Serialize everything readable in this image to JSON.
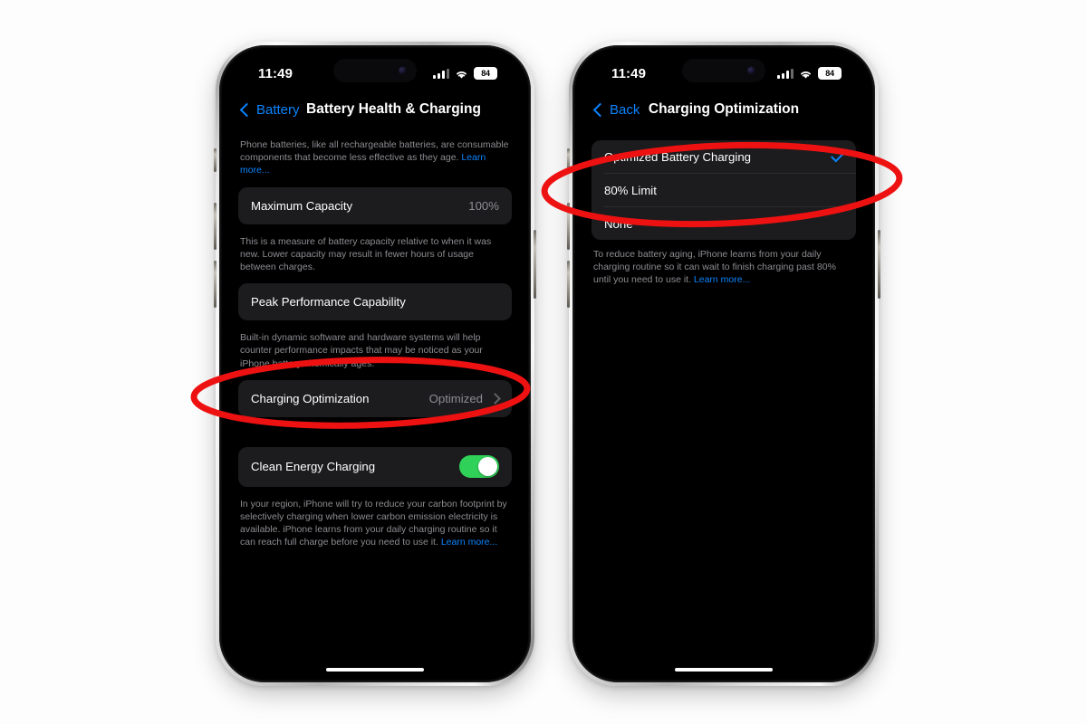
{
  "colors": {
    "accent_blue": "#0a84ff",
    "toggle_green": "#30d158",
    "annotation_red": "#ee1111",
    "card_bg": "#1c1c1e",
    "screen_bg": "#000000",
    "secondary_text": "#8d8d93"
  },
  "status_bar": {
    "time": "11:49",
    "battery_percent": "84",
    "signal_icon": "cellular-signal-icon",
    "wifi_icon": "wifi-icon",
    "battery_icon": "battery-icon"
  },
  "left_phone": {
    "nav": {
      "back_label": "Battery",
      "title": "Battery Health & Charging"
    },
    "intro_note": "Phone batteries, like all rechargeable batteries, are consumable components that become less effective as they age. ",
    "intro_link": "Learn more...",
    "maximum_capacity": {
      "label": "Maximum Capacity",
      "value": "100%"
    },
    "capacity_note": "This is a measure of battery capacity relative to when it was new. Lower capacity may result in fewer hours of usage between charges.",
    "peak_performance": {
      "label": "Peak Performance Capability"
    },
    "peak_note": "Built-in dynamic software and hardware systems will help counter performance impacts that may be noticed as your iPhone battery chemically ages.",
    "charging_optimization": {
      "label": "Charging Optimization",
      "value": "Optimized"
    },
    "clean_energy": {
      "label": "Clean Energy Charging",
      "toggle_state": "on"
    },
    "clean_energy_note": "In your region, iPhone will try to reduce your carbon footprint by selectively charging when lower carbon emission electricity is available. iPhone learns from your daily charging routine so it can reach full charge before you need to use it. ",
    "clean_energy_link": "Learn more..."
  },
  "right_phone": {
    "nav": {
      "back_label": "Back",
      "title": "Charging Optimization"
    },
    "options": [
      {
        "label": "Optimized Battery Charging",
        "selected": true
      },
      {
        "label": "80% Limit",
        "selected": false
      },
      {
        "label": "None",
        "selected": false
      }
    ],
    "footer_note": "To reduce battery aging, iPhone learns from your daily charging routine so it can wait to finish charging past 80% until you need to use it. ",
    "footer_link": "Learn more..."
  },
  "annotations": [
    {
      "name": "red-ellipse-charging-optimization-row",
      "target": "Charging Optimization"
    },
    {
      "name": "red-ellipse-charging-options",
      "target": "Optimized Battery Charging / 80% Limit"
    }
  ]
}
